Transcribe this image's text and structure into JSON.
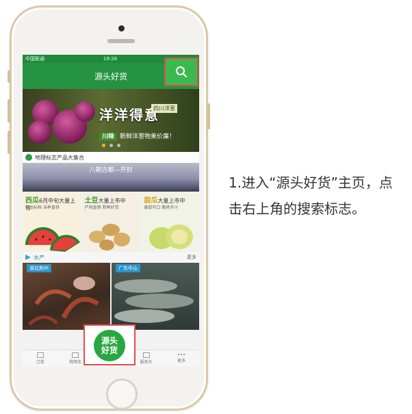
{
  "status_bar": {
    "carrier": "中国联通",
    "time": "19:26"
  },
  "header": {
    "title": "源头好货",
    "search_icon": "search-icon"
  },
  "banner": {
    "headline": "洋洋得意",
    "tag": "四川洋葱",
    "badge": "川味",
    "subtitle": "新鲜洋葱物美价廉！"
  },
  "sections": {
    "geo": {
      "title": "地理标志产品大集合"
    },
    "city_banner": "八朝古都—开封",
    "aquatic": {
      "title": "水产",
      "more": "更多"
    }
  },
  "produce": [
    {
      "name": "西瓜",
      "detail": "6月中旬大量上市",
      "desc": "精品标档 当季直供"
    },
    {
      "name": "土豆",
      "detail": "大量上市中",
      "desc": "产地直销 新鲜好货"
    },
    {
      "name": "甜瓜",
      "detail": "大量上市中",
      "desc": "香甜可口 脆爽多汁"
    }
  ],
  "aquatic_items": [
    {
      "location": "湖北荆州"
    },
    {
      "location": "广东中山"
    }
  ],
  "tabs": [
    {
      "label": "订单"
    },
    {
      "label": "购物车"
    },
    {
      "label": ""
    },
    {
      "label": "服务社"
    },
    {
      "label": "更多"
    }
  ],
  "center_badge": {
    "line1": "源头",
    "line2": "好货"
  },
  "instruction": "1.进入“源头好货”主页，点击右上角的搜索标志。",
  "colors": {
    "brand_green": "#269342",
    "highlight_red": "#e14b4b",
    "gold_frame": "#d9c9a7"
  }
}
